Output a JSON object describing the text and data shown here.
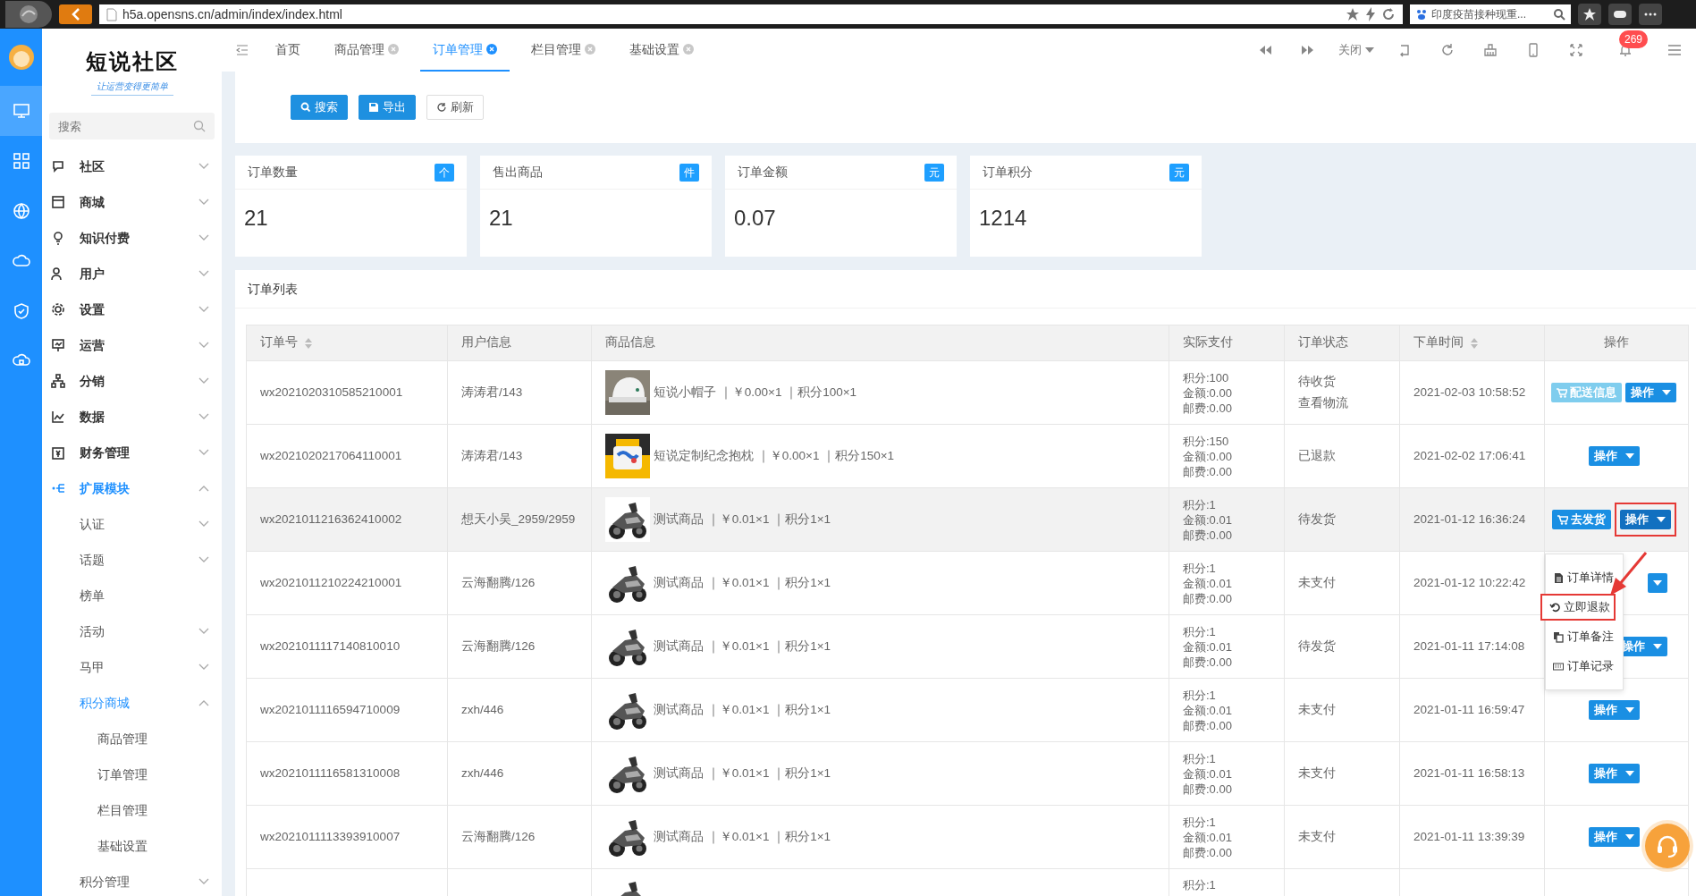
{
  "browser": {
    "url": "h5a.opensns.cn/admin/index/index.html",
    "search": "印度疫苗接种现重..."
  },
  "rail": [
    {
      "selected": true
    },
    {
      "selected": false
    },
    {
      "selected": false
    },
    {
      "selected": false
    },
    {
      "selected": false
    },
    {
      "selected": false
    }
  ],
  "logo": {
    "title": "短说社区",
    "slogan": "让运营变得更简单"
  },
  "sidebar": {
    "search_placeholder": "搜索",
    "items": [
      {
        "label": "社区",
        "expandable": true,
        "expanded": false,
        "selected": false
      },
      {
        "label": "商城",
        "expandable": true,
        "expanded": false,
        "selected": false
      },
      {
        "label": "知识付费",
        "expandable": true,
        "expanded": false,
        "selected": false
      },
      {
        "label": "用户",
        "expandable": true,
        "expanded": false,
        "selected": false
      },
      {
        "label": "设置",
        "expandable": true,
        "expanded": false,
        "selected": false
      },
      {
        "label": "运营",
        "expandable": true,
        "expanded": false,
        "selected": false
      },
      {
        "label": "分销",
        "expandable": true,
        "expanded": false,
        "selected": false
      },
      {
        "label": "数据",
        "expandable": true,
        "expanded": false,
        "selected": false
      },
      {
        "label": "财务管理",
        "expandable": true,
        "expanded": false,
        "selected": false
      },
      {
        "label": "扩展模块",
        "expandable": true,
        "expanded": true,
        "selected": true,
        "children": [
          {
            "label": "认证",
            "expandable": true,
            "expanded": false,
            "selected": false
          },
          {
            "label": "话题",
            "expandable": true,
            "expanded": false,
            "selected": false
          },
          {
            "label": "榜单",
            "expandable": false,
            "selected": false
          },
          {
            "label": "活动",
            "expandable": true,
            "expanded": false,
            "selected": false
          },
          {
            "label": "马甲",
            "expandable": true,
            "expanded": false,
            "selected": false
          },
          {
            "label": "积分商城",
            "expandable": true,
            "expanded": true,
            "selected": true,
            "children": [
              {
                "label": "商品管理",
                "expandable": false,
                "selected": false
              },
              {
                "label": "订单管理",
                "expandable": false,
                "selected": false
              },
              {
                "label": "栏目管理",
                "expandable": false,
                "selected": false
              },
              {
                "label": "基础设置",
                "expandable": false,
                "selected": false
              }
            ]
          },
          {
            "label": "积分管理",
            "expandable": true,
            "expanded": false,
            "selected": false
          }
        ]
      }
    ]
  },
  "tabs": [
    {
      "label": "首页",
      "closable": false,
      "selected": false
    },
    {
      "label": "商品管理",
      "closable": true,
      "selected": false
    },
    {
      "label": "订单管理",
      "closable": true,
      "selected": true
    },
    {
      "label": "栏目管理",
      "closable": true,
      "selected": false
    },
    {
      "label": "基础设置",
      "closable": true,
      "selected": false
    }
  ],
  "toolbar": {
    "close_label": "关闭",
    "notifications": "269"
  },
  "filter_buttons": [
    {
      "label": "搜索",
      "kind": "primary"
    },
    {
      "label": "导出",
      "kind": "primary"
    },
    {
      "label": "刷新",
      "kind": "default"
    }
  ],
  "stats": [
    {
      "title": "订单数量",
      "unit": "个",
      "value": "21"
    },
    {
      "title": "售出商品",
      "unit": "件",
      "value": "21"
    },
    {
      "title": "订单金额",
      "unit": "元",
      "value": "0.07"
    },
    {
      "title": "订单积分",
      "unit": "元",
      "value": "1214"
    }
  ],
  "orders": {
    "title": "订单列表",
    "columns": [
      {
        "label": "订单号",
        "sortable": true
      },
      {
        "label": "用户信息",
        "sortable": false
      },
      {
        "label": "商品信息",
        "sortable": false
      },
      {
        "label": "实际支付",
        "sortable": false
      },
      {
        "label": "订单状态",
        "sortable": false
      },
      {
        "label": "下单时间",
        "sortable": true
      },
      {
        "label": "操作",
        "sortable": false
      }
    ],
    "rows": [
      {
        "order_no": "wx2021020310585210001",
        "user": "涛涛君/143",
        "product": "短说小帽子 ｜￥0.00×1 ｜积分100×1",
        "payment": [
          "积分:100",
          "金额:0.00",
          "邮费:0.00"
        ],
        "status": [
          "待收货",
          "查看物流"
        ],
        "time": "2021-02-03 10:58:52",
        "highlighted": false,
        "actions": [
          {
            "kind": "ship-info",
            "label": "配送信息",
            "annotated": false,
            "open": false
          },
          {
            "kind": "menu",
            "label": "操作",
            "annotated": false,
            "open": false
          }
        ]
      },
      {
        "order_no": "wx2021020217064110001",
        "user": "涛涛君/143",
        "product": "短说定制纪念抱枕 ｜￥0.00×1 ｜积分150×1",
        "payment": [
          "积分:150",
          "金额:0.00",
          "邮费:0.00"
        ],
        "status": [
          "已退款"
        ],
        "time": "2021-02-02 17:06:41",
        "highlighted": false,
        "actions": [
          {
            "kind": "menu",
            "label": "操作",
            "annotated": false,
            "open": false
          }
        ]
      },
      {
        "order_no": "wx2021011216362410002",
        "user": "想天小吴_2959/2959",
        "product": "测试商品 ｜￥0.01×1 ｜积分1×1",
        "payment": [
          "积分:1",
          "金额:0.01",
          "邮费:0.00"
        ],
        "status": [
          "待发货"
        ],
        "time": "2021-01-12 16:36:24",
        "highlighted": true,
        "actions": [
          {
            "kind": "ship",
            "label": "去发货",
            "annotated": false,
            "open": false
          },
          {
            "kind": "menu",
            "label": "操作",
            "annotated": true,
            "open": true
          }
        ]
      },
      {
        "order_no": "wx2021011210224210001",
        "user": "云海翻腾/126",
        "product": "测试商品 ｜￥0.01×1 ｜积分1×1",
        "payment": [
          "积分:1",
          "金额:0.01",
          "邮费:0.00"
        ],
        "status": [
          "未支付"
        ],
        "time": "2021-01-12 10:22:42",
        "highlighted": false,
        "actions": [
          {
            "kind": "menu",
            "open": false
          }
        ]
      },
      {
        "order_no": "wx2021011117140810010",
        "user": "云海翻腾/126",
        "product": "测试商品 ｜￥0.01×1 ｜积分1×1",
        "payment": [
          "积分:1",
          "金额:0.01",
          "邮费:0.00"
        ],
        "status": [
          "待发货"
        ],
        "time": "2021-01-11 17:14:08",
        "highlighted": false,
        "actions": [
          {
            "kind": "menu",
            "label": "操作",
            "annotated": false,
            "open": false
          }
        ]
      },
      {
        "order_no": "wx2021011116594710009",
        "user": "zxh/446",
        "product": "测试商品 ｜￥0.01×1 ｜积分1×1",
        "payment": [
          "积分:1",
          "金额:0.01",
          "邮费:0.00"
        ],
        "status": [
          "未支付"
        ],
        "time": "2021-01-11 16:59:47",
        "highlighted": false,
        "actions": [
          {
            "kind": "menu",
            "label": "操作",
            "annotated": false,
            "open": false
          }
        ]
      },
      {
        "order_no": "wx2021011116581310008",
        "user": "zxh/446",
        "product": "测试商品 ｜￥0.01×1 ｜积分1×1",
        "payment": [
          "积分:1",
          "金额:0.01",
          "邮费:0.00"
        ],
        "status": [
          "未支付"
        ],
        "time": "2021-01-11 16:58:13",
        "highlighted": false,
        "actions": [
          {
            "kind": "menu",
            "label": "操作",
            "annotated": false,
            "open": false
          }
        ]
      },
      {
        "order_no": "wx2021011113393910007",
        "user": "云海翻腾/126",
        "product": "测试商品 ｜￥0.01×1 ｜积分1×1",
        "payment": [
          "积分:1",
          "金额:0.01",
          "邮费:0.00"
        ],
        "status": [
          "未支付"
        ],
        "time": "2021-01-11 13:39:39",
        "highlighted": false,
        "actions": [
          {
            "kind": "menu",
            "label": "操作",
            "annotated": false,
            "open": false
          }
        ]
      },
      {
        "payment": [
          "积分:1"
        ],
        "highlighted": false,
        "actions": []
      }
    ],
    "menu": [
      {
        "label": "订单详情",
        "annotated": false
      },
      {
        "label": "立即退款",
        "annotated": true
      },
      {
        "label": "订单备注",
        "annotated": false
      },
      {
        "label": "订单记录",
        "annotated": false
      }
    ]
  }
}
